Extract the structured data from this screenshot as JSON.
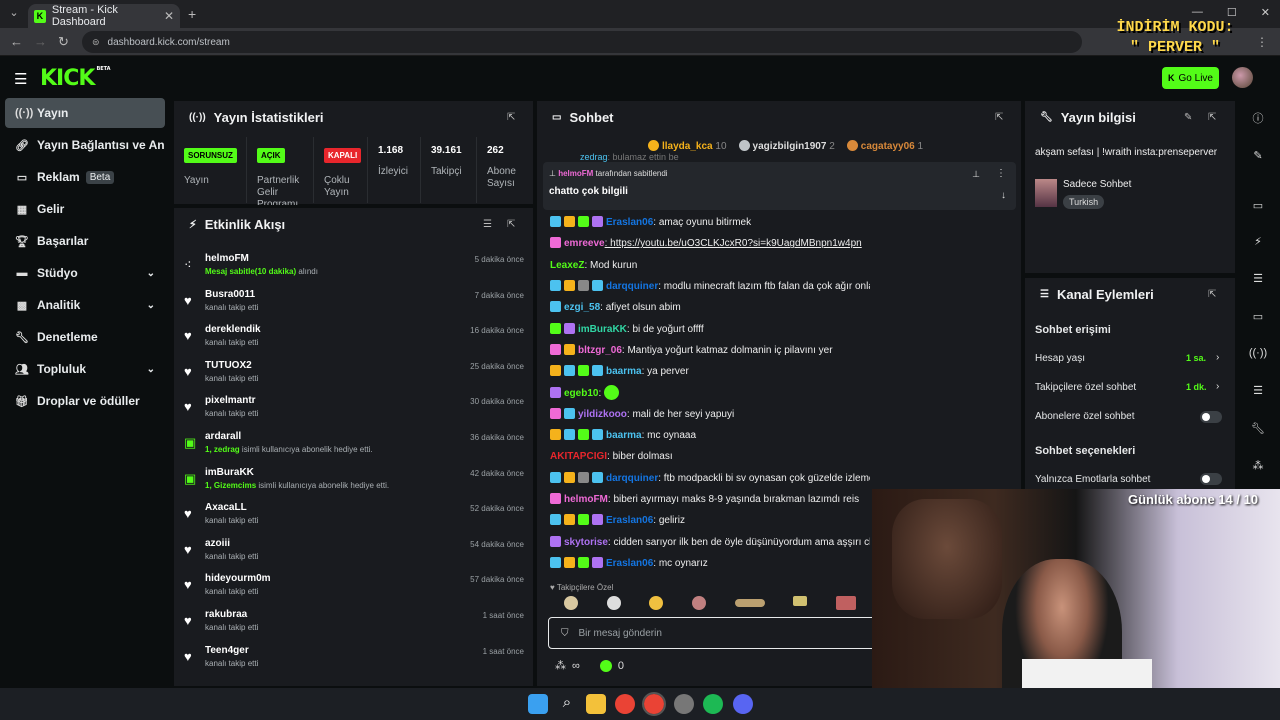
{
  "browser": {
    "tab_title": "Stream - Kick Dashboard",
    "url": "dashboard.kick.com/stream",
    "promo_line1": "İNDİRİM KODU:",
    "promo_line2": "\" PERVER \""
  },
  "header": {
    "logo": "KICK",
    "logo_sup": "BETA",
    "go_live": "Go Live"
  },
  "sidebar": {
    "items": [
      {
        "label": "Yayın",
        "icon": "broadcast-icon"
      },
      {
        "label": "Yayın Bağlantısı ve Anahtar",
        "icon": "link-icon"
      },
      {
        "label": "Reklam",
        "icon": "ad-icon",
        "badge": "Beta"
      },
      {
        "label": "Gelir",
        "icon": "chart-icon"
      },
      {
        "label": "Başarılar",
        "icon": "trophy-icon"
      },
      {
        "label": "Stüdyo",
        "icon": "studio-icon"
      },
      {
        "label": "Analitik",
        "icon": "analytics-icon"
      },
      {
        "label": "Denetleme",
        "icon": "wrench-icon"
      },
      {
        "label": "Topluluk",
        "icon": "community-icon"
      },
      {
        "label": "Droplar ve ödüller",
        "icon": "gift-icon"
      }
    ]
  },
  "stats": {
    "title": "Yayın İstatistikleri",
    "items": [
      {
        "value": "SORUNSUZ",
        "label": "Yayın",
        "color": "#53fc18"
      },
      {
        "value": "AÇIK",
        "label": "Partnerlik Gelir Programı",
        "color": "#53fc18"
      },
      {
        "value": "KAPALI",
        "label": "Çoklu Yayın",
        "color": "#e8262c"
      },
      {
        "value": "1.168",
        "label": "İzleyici"
      },
      {
        "value": "39.161",
        "label": "Takipçi"
      },
      {
        "value": "262",
        "label": "Abone Sayısı"
      }
    ]
  },
  "activity": {
    "title": "Etkinlik Akışı",
    "events": [
      {
        "name": "helmoFM",
        "desc_hl": "Mesaj sabitle(10 dakika)",
        "desc": " alındı",
        "time": "5 dakika önce"
      },
      {
        "name": "Busra0011",
        "desc_hl": "",
        "desc": "kanalı takip etti",
        "time": "7 dakika önce"
      },
      {
        "name": "dereklendik",
        "desc_hl": "",
        "desc": "kanalı takip etti",
        "time": "16 dakika önce"
      },
      {
        "name": "TUTUOX2",
        "desc_hl": "",
        "desc": "kanalı takip etti",
        "time": "25 dakika önce"
      },
      {
        "name": "pixelmantr",
        "desc_hl": "",
        "desc": "kanalı takip etti",
        "time": "30 dakika önce"
      },
      {
        "name": "ardarall",
        "desc_hl": "1, zedrag",
        "desc": " isimli kullanıcıya abonelik hediye etti.",
        "time": "36 dakika önce"
      },
      {
        "name": "imBuraKK",
        "desc_hl": "1, Gizemcims",
        "desc": " isimli kullanıcıya abonelik hediye etti.",
        "time": "42 dakika önce"
      },
      {
        "name": "AxacaLL",
        "desc_hl": "",
        "desc": "kanalı takip etti",
        "time": "52 dakika önce"
      },
      {
        "name": "azoiii",
        "desc_hl": "",
        "desc": "kanalı takip etti",
        "time": "54 dakika önce"
      },
      {
        "name": "hideyourm0m",
        "desc_hl": "",
        "desc": "kanalı takip etti",
        "time": "57 dakika önce"
      },
      {
        "name": "rakubraa",
        "desc_hl": "",
        "desc": "kanalı takip etti",
        "time": "1 saat önce"
      },
      {
        "name": "Teen4ger",
        "desc_hl": "",
        "desc": "kanalı takip etti",
        "time": "1 saat önce"
      }
    ]
  },
  "chat": {
    "title": "Sohbet",
    "leaders": [
      {
        "name": "llayda_kca",
        "count": "10",
        "color": "#f5b21b"
      },
      {
        "name": "yagizbilgin1907",
        "count": "2",
        "color": "#bfc4c8"
      },
      {
        "name": "cagatayy06",
        "count": "1",
        "color": "#d8893a"
      }
    ],
    "pinned_by": "helmoFM",
    "pinned_by_suffix": " tarafından sabitlendi",
    "pinned_text": "chatto çok bilgili",
    "partial_top_user": "zedrag",
    "partial_top_text": ": bulamaz ettin be",
    "messages": [
      {
        "user": "Eraslan06",
        "text": ": amaç oyunu bitirmek",
        "color": "#1475e1"
      },
      {
        "user": "emreeve",
        "text": ": https://youtu.be/uO3CLKJcxR0?si=k9UagdMBnpn1w4pn",
        "color": "#ef6ad6"
      },
      {
        "user": "LeaxeZ",
        "text": ": Mod kurun",
        "color": "#53fc18"
      },
      {
        "user": "darqquiner",
        "text": ": modlu minecraft lazım ftb falan da çok ağır onlarda",
        "color": "#1475e1"
      },
      {
        "user": "ezgi_58",
        "text": ": afiyet olsun abim",
        "color": "#4cc2ef"
      },
      {
        "user": "imBuraKK",
        "text": ": bi de yoğurt offff",
        "color": "#31d6a4"
      },
      {
        "user": "bltzgr_06",
        "text": ": Mantiya yoğurt katmaz dolmanin iç pilavını yer",
        "color": "#ef6ad6"
      },
      {
        "user": "baarma",
        "text": ": ya perver",
        "color": "#4cc2ef"
      },
      {
        "user": "egeb10",
        "text": ":",
        "color": "#53fc18"
      },
      {
        "user": "yildizkooo",
        "text": ": mali de her seyi yapuyi",
        "color": "#ae72f2"
      },
      {
        "user": "baarma",
        "text": ": mc oynaaa",
        "color": "#4cc2ef"
      },
      {
        "user": "AKITAPCIGI",
        "text": ": biber dolması",
        "color": "#e8262c"
      },
      {
        "user": "darqquiner",
        "text": ": ftb modpackli bi sv oynasan çok güzelde izlememm",
        "color": "#1475e1"
      },
      {
        "user": "helmoFM",
        "text": ": biberi ayırmayı maks 8-9 yaşında bırakman lazımdı reis",
        "color": "#ef6ad6"
      },
      {
        "user": "Eraslan06",
        "text": ": geliriz",
        "color": "#1475e1"
      },
      {
        "user": "skytorise",
        "text": ": cidden sarıyor ilk ben de öyle düşünüyordum ama aşşırı ch",
        "color": "#ae72f2"
      },
      {
        "user": "Eraslan06",
        "text": ": mc oynarız",
        "color": "#1475e1"
      }
    ],
    "emote_section": "Takipçilere Özel",
    "input_placeholder": "Bir mesaj gönderin",
    "footer_infinity": "∞",
    "footer_points": "0"
  },
  "stream_info": {
    "title": "Yayın bilgisi",
    "stream_title": "akşam sefası | !wraith insta:prenseperver",
    "category": "Sadece Sohbet",
    "language": "Turkish"
  },
  "channel_actions": {
    "title": "Kanal Eylemleri",
    "section1": "Sohbet erişimi",
    "rows": [
      {
        "label": "Hesap yaşı",
        "value": "1 sa."
      },
      {
        "label": "Takipçilere özel sohbet",
        "value": "1 dk."
      },
      {
        "label": "Abonelere özel sohbet",
        "value": ""
      }
    ],
    "section2": "Sohbet seçenekleri",
    "row_emote": "Yalnızca Emotlarla sohbet"
  },
  "webcam": {
    "overlay": "Günlük abone 14 / 10"
  }
}
